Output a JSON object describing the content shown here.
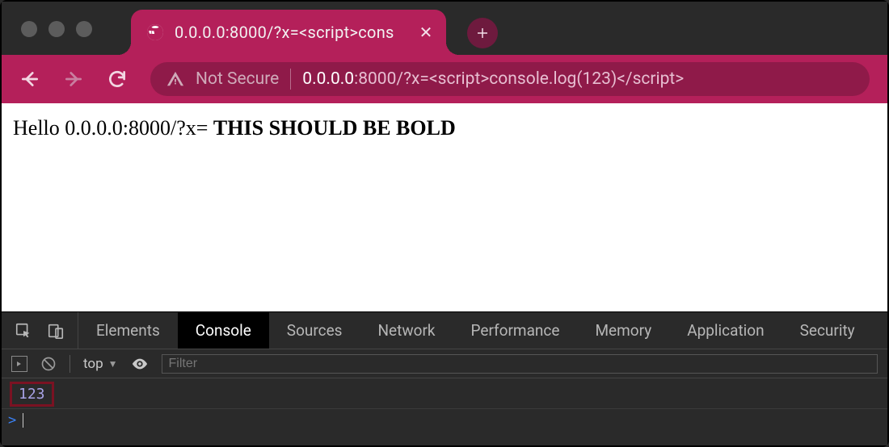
{
  "titlebar": {
    "tab_title": "0.0.0.0:8000/?x=<script>cons",
    "tab_close_glyph": "✕",
    "newtab_glyph": "+"
  },
  "toolbar": {
    "not_secure": "Not Secure",
    "url_host": "0.0.0.0",
    "url_path": ":8000/?x=<script>console.log(123)</script>"
  },
  "page": {
    "plain_text": "Hello 0.0.0.0:8000/?x= ",
    "bold_text": "THIS SHOULD BE BOLD"
  },
  "devtools": {
    "tabs": [
      "Elements",
      "Console",
      "Sources",
      "Network",
      "Performance",
      "Memory",
      "Application",
      "Security"
    ],
    "active_tab": "Console",
    "context_label": "top",
    "context_caret": "▼",
    "filter_placeholder": "Filter",
    "log_value": "123",
    "prompt_chevron": ">"
  }
}
